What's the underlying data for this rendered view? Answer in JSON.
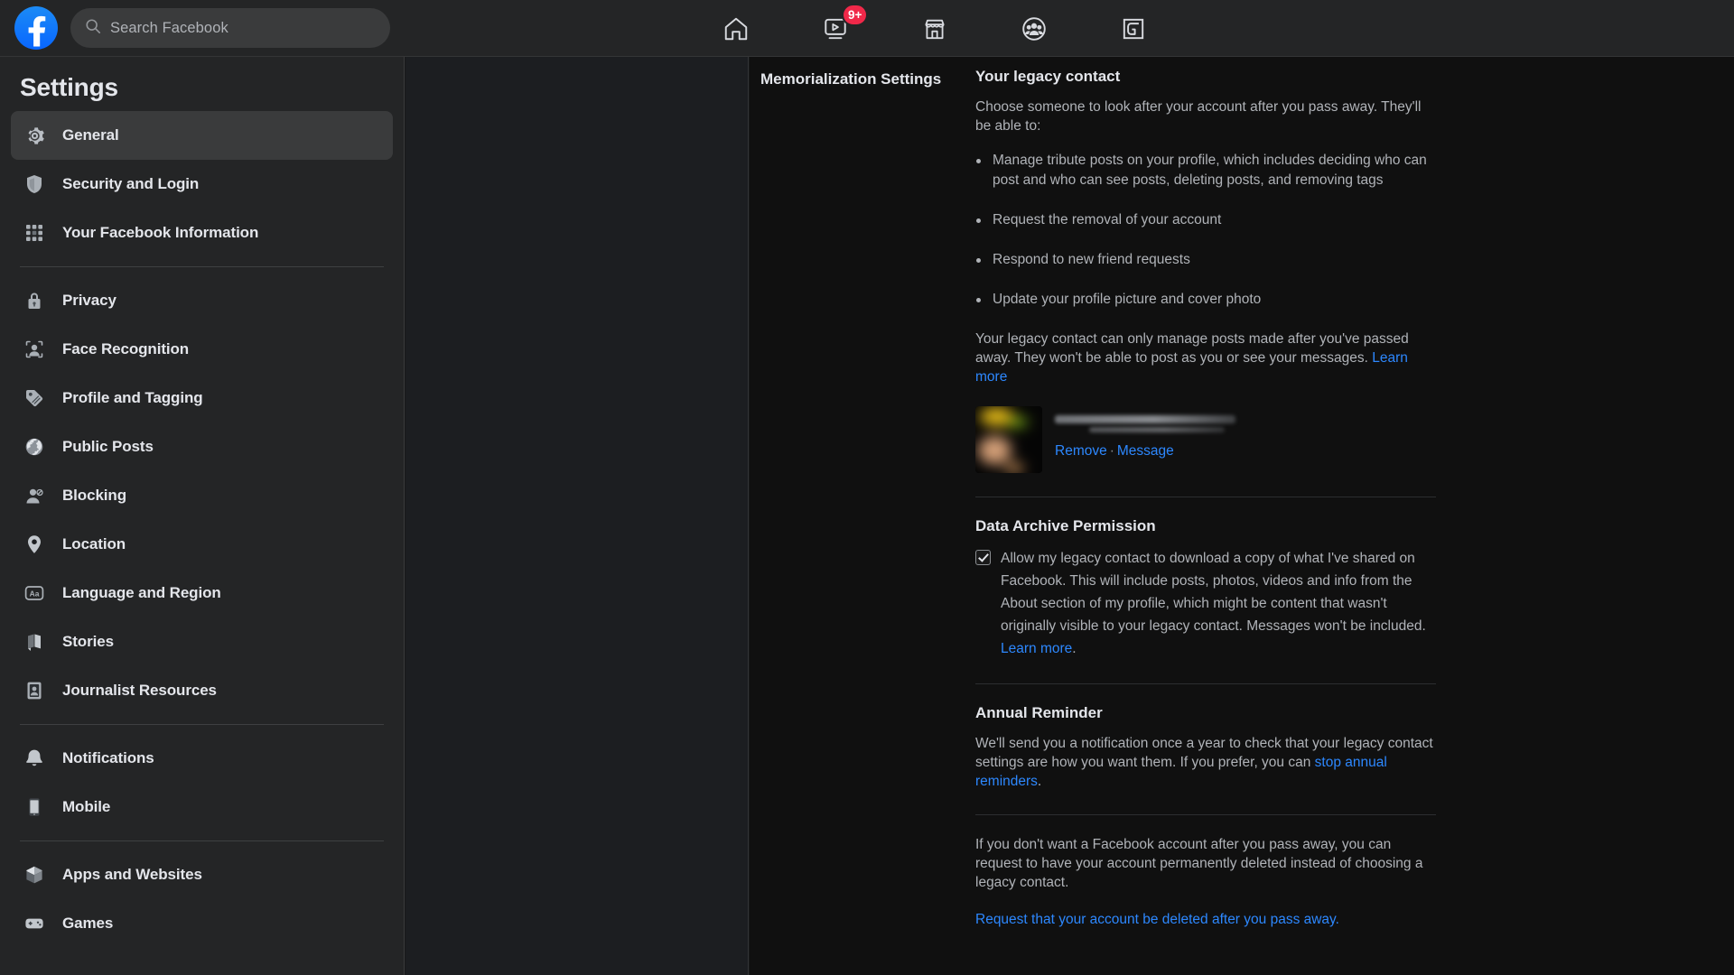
{
  "topbar": {
    "logo_icon": "facebook-logo-icon",
    "search": {
      "placeholder": "Search Facebook",
      "icon": "search-icon"
    },
    "nav": [
      {
        "name": "home",
        "icon": "home-icon",
        "badge": ""
      },
      {
        "name": "watch",
        "icon": "watch-video-icon",
        "badge": "9+"
      },
      {
        "name": "marketplace",
        "icon": "marketplace-storefront-icon",
        "badge": ""
      },
      {
        "name": "groups",
        "icon": "groups-people-icon",
        "badge": ""
      },
      {
        "name": "gaming",
        "icon": "gaming-icon",
        "badge": ""
      }
    ]
  },
  "sidebar": {
    "title": "Settings",
    "groups": [
      [
        {
          "label": "General",
          "icon": "gear-icon",
          "active": true
        },
        {
          "label": "Security and Login",
          "icon": "shield-icon",
          "active": false
        },
        {
          "label": "Your Facebook Information",
          "icon": "grid-dots-icon",
          "active": false
        }
      ],
      [
        {
          "label": "Privacy",
          "icon": "lock-icon",
          "active": false
        },
        {
          "label": "Face Recognition",
          "icon": "face-recognition-icon",
          "active": false
        },
        {
          "label": "Profile and Tagging",
          "icon": "tag-icon",
          "active": false
        },
        {
          "label": "Public Posts",
          "icon": "globe-icon",
          "active": false
        },
        {
          "label": "Blocking",
          "icon": "block-person-icon",
          "active": false
        },
        {
          "label": "Location",
          "icon": "location-pin-icon",
          "active": false
        },
        {
          "label": "Language and Region",
          "icon": "language-aa-icon",
          "active": false
        },
        {
          "label": "Stories",
          "icon": "book-icon",
          "active": false
        },
        {
          "label": "Journalist Resources",
          "icon": "id-badge-icon",
          "active": false
        }
      ],
      [
        {
          "label": "Notifications",
          "icon": "bell-icon",
          "active": false
        },
        {
          "label": "Mobile",
          "icon": "mobile-phone-icon",
          "active": false
        }
      ],
      [
        {
          "label": "Apps and Websites",
          "icon": "cube-icon",
          "active": false
        },
        {
          "label": "Games",
          "icon": "gamepad-icon",
          "active": false
        }
      ]
    ]
  },
  "content": {
    "breadcrumb": "Memorialization Settings",
    "legacy": {
      "title": "Your legacy contact",
      "intro": "Choose someone to look after your account after you pass away. They'll be able to:",
      "bullets": [
        "Manage tribute posts on your profile, which includes deciding who can post and who can see posts, deleting posts, and removing tags",
        "Request the removal of your account",
        "Respond to new friend requests",
        "Update your profile picture and cover photo"
      ],
      "note": "Your legacy contact can only manage posts made after you've passed away. They won't be able to post as you or see your messages.",
      "note_link": "Learn more",
      "contact": {
        "name_redacted": true,
        "remove_label": "Remove",
        "separator": "·",
        "message_label": "Message",
        "avatar_icon": "contact-avatar"
      }
    },
    "data_archive": {
      "title": "Data Archive Permission",
      "checkbox_checked": true,
      "label_part1": "Allow my legacy contact to download a copy of what I've shared on Facebook. This will include posts, photos, videos and info from the About section of my profile, which might be content that wasn't originally visible to your legacy contact. Messages won't be included. ",
      "label_link": "Learn more",
      "label_part2": "."
    },
    "annual_reminder": {
      "title": "Annual Reminder",
      "text_part1": "We'll send you a notification once a year to check that your legacy contact settings are how you want them. If you prefer, you can ",
      "link": "stop annual reminders",
      "text_part2": "."
    },
    "deletion": {
      "text": "If you don't want a Facebook account after you pass away, you can request to have your account permanently deleted instead of choosing a legacy contact.",
      "link": "Request that your account be deleted after you pass away."
    }
  },
  "colors": {
    "accent_blue": "#2d88ff",
    "brand_blue": "#0866ff",
    "badge_red": "#f02849",
    "panel_bg": "#242526",
    "content_bg": "#101010",
    "text_primary": "#e4e6eb",
    "text_secondary": "#b0b3b8"
  }
}
